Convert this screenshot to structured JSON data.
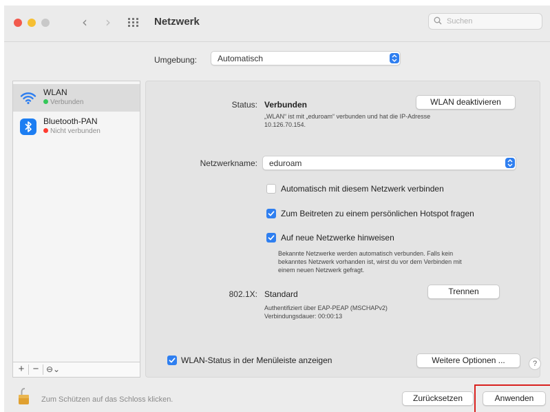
{
  "window": {
    "title": "Netzwerk"
  },
  "search": {
    "placeholder": "Suchen"
  },
  "location": {
    "label": "Umgebung:",
    "value": "Automatisch"
  },
  "sidebar": {
    "items": [
      {
        "name": "WLAN",
        "status": "Verbunden",
        "status_color": "#34c759",
        "icon": "wifi-icon",
        "selected": true
      },
      {
        "name": "Bluetooth-PAN",
        "status": "Nicht verbunden",
        "status_color": "#ff3b30",
        "icon": "bluetooth-icon",
        "selected": false
      }
    ],
    "add_label": "+",
    "remove_label": "−",
    "action_label": "⊖⌄"
  },
  "status": {
    "label": "Status:",
    "value": "Verbunden",
    "toggle_button": "WLAN deaktivieren",
    "description_line1": "„WLAN“ ist mit „eduroam“ verbunden und hat die IP-Adresse",
    "description_line2": "10.126.70.154."
  },
  "network_name": {
    "label": "Netzwerkname:",
    "value": "eduroam"
  },
  "options": [
    {
      "label": "Automatisch mit diesem Netzwerk verbinden",
      "checked": false
    },
    {
      "label": "Zum Beitreten zu einem persönlichen Hotspot fragen",
      "checked": true
    },
    {
      "label": "Auf neue Netzwerke hinweisen",
      "checked": true
    }
  ],
  "new_networks_note": {
    "line1": "Bekannte Netzwerke werden automatisch verbunden. Falls kein",
    "line2": "bekanntes Netzwerk vorhanden ist, wirst du vor dem Verbinden mit",
    "line3": "einem neuen Netzwerk gefragt."
  },
  "dot1x": {
    "label": "802.1X:",
    "value": "Standard",
    "button": "Trennen",
    "auth_line": "Authentifiziert über EAP-PEAP (MSCHAPv2)",
    "duration_line": "Verbindungsdauer: 00:00:13"
  },
  "menubar_status": {
    "label": "WLAN-Status in der Menüleiste anzeigen",
    "checked": true
  },
  "more_options_button": "Weitere Optionen ...",
  "help_label": "?",
  "footer": {
    "lock_text": "Zum Schützen auf das Schloss klicken.",
    "revert_button": "Zurücksetzen",
    "apply_button": "Anwenden"
  },
  "colors": {
    "accent": "#2f7ff0",
    "highlight": "#d9201d"
  }
}
